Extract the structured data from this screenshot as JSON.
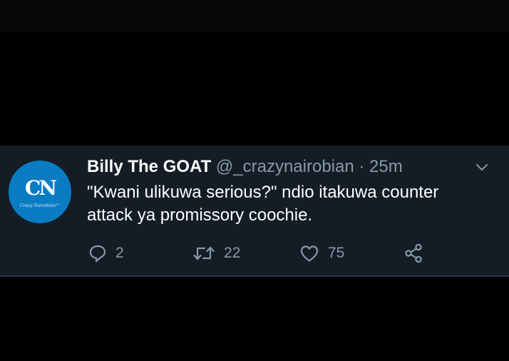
{
  "tweet": {
    "avatar": {
      "mark": "CN",
      "tagline": "Crazy Nairobian™"
    },
    "display_name": "Billy The GOAT",
    "handle": "@_crazynairobian",
    "separator": " · ",
    "time": "25m",
    "text": "\"Kwani ulikuwa serious?\" ndio itakuwa counter\nattack ya promissory coochie.",
    "actions": {
      "reply_count": "2",
      "retweet_count": "22",
      "like_count": "75"
    }
  },
  "colors": {
    "background": "#000000",
    "card": "#141d26",
    "text": "#ffffff",
    "muted": "#8899a6",
    "avatar": "#0a7cc4"
  }
}
